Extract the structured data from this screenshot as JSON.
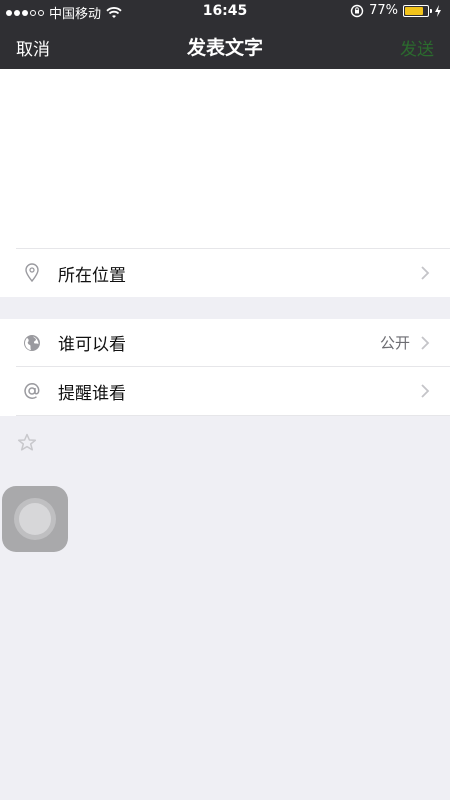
{
  "status_bar": {
    "carrier": "中国移动",
    "time": "16:45",
    "battery_percent": "77%",
    "battery_level": 0.77,
    "signal_bars_filled": 3,
    "signal_bars_total": 5
  },
  "nav": {
    "cancel_label": "取消",
    "title": "发表文字",
    "send_label": "发送"
  },
  "compose": {
    "text": ""
  },
  "rows": {
    "location": {
      "label": "所在位置",
      "value": ""
    },
    "visibility": {
      "label": "谁可以看",
      "value": "公开"
    },
    "remind": {
      "label": "提醒谁看",
      "value": ""
    }
  },
  "icons": {
    "location": "location-pin-icon",
    "visibility": "globe-icon",
    "remind": "at-sign-icon",
    "favorite": "star-icon",
    "chevron": "chevron-right-icon"
  },
  "colors": {
    "topbar": "#2f2f33",
    "send_disabled": "#2b6b2e",
    "background": "#efeff4",
    "battery": "#f2c31b"
  }
}
